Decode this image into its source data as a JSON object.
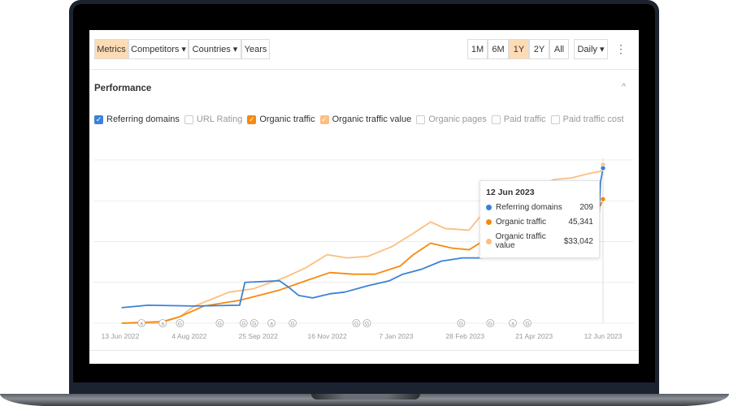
{
  "toolbar": {
    "left": [
      "Metrics",
      "Competitors ▾",
      "Countries ▾",
      "Years"
    ],
    "ranges": [
      "1M",
      "6M",
      "1Y",
      "2Y",
      "All"
    ],
    "active_range": "1Y",
    "interval": "Daily ▾",
    "more": "⋮"
  },
  "section": {
    "title": "Performance",
    "collapse": "^"
  },
  "metrics": [
    {
      "label": "Referring domains",
      "checked": true,
      "color": "#3b82d6"
    },
    {
      "label": "URL Rating",
      "checked": false,
      "color": ""
    },
    {
      "label": "Organic traffic",
      "checked": true,
      "color": "#f7890e"
    },
    {
      "label": "Organic traffic value",
      "checked": true,
      "color": "#fbbf80"
    },
    {
      "label": "Organic pages",
      "checked": false,
      "color": ""
    },
    {
      "label": "Paid traffic",
      "checked": false,
      "color": ""
    },
    {
      "label": "Paid traffic cost",
      "checked": false,
      "color": ""
    }
  ],
  "tooltip": {
    "date": "12 Jun 2023",
    "rows": [
      {
        "label": "Referring domains",
        "value": "209",
        "color": "#3b82d6"
      },
      {
        "label": "Organic traffic",
        "value": "45,341",
        "color": "#f7890e"
      },
      {
        "label": "Organic traffic value",
        "value": "$33,042",
        "color": "#fbbf80"
      }
    ]
  },
  "chart_data": {
    "type": "line",
    "x_unit": "days since 13 Jun 2022",
    "y_unit": "relative (0-100)",
    "ylim": [
      0,
      100
    ],
    "xlim": [
      0,
      364
    ],
    "grid": true,
    "x_ticks": [
      {
        "label": "13 Jun 2022",
        "day": 0
      },
      {
        "label": "4 Aug 2022",
        "day": 52
      },
      {
        "label": "25 Sep 2022",
        "day": 104
      },
      {
        "label": "16 Nov 2022",
        "day": 156
      },
      {
        "label": "7 Jan 2023",
        "day": 208
      },
      {
        "label": "28 Feb 2023",
        "day": 260
      },
      {
        "label": "21 Apr 2023",
        "day": 312
      },
      {
        "label": "12 Jun 2023",
        "day": 364
      }
    ],
    "series": [
      {
        "name": "Organic traffic value",
        "color": "#fbbf80",
        "points": [
          [
            1,
            0
          ],
          [
            30,
            0
          ],
          [
            45,
            4
          ],
          [
            56,
            10.5
          ],
          [
            82,
            19
          ],
          [
            100,
            21
          ],
          [
            124,
            28
          ],
          [
            140,
            34
          ],
          [
            156,
            42
          ],
          [
            171,
            40
          ],
          [
            187,
            41
          ],
          [
            205,
            47
          ],
          [
            219,
            54
          ],
          [
            234,
            62
          ],
          [
            245,
            58
          ],
          [
            263,
            57
          ],
          [
            271,
            65
          ],
          [
            290,
            72
          ],
          [
            310,
            82
          ],
          [
            327,
            88
          ],
          [
            340,
            89
          ],
          [
            355,
            92
          ],
          [
            362,
            93
          ],
          [
            364,
            97
          ]
        ]
      },
      {
        "name": "Organic traffic",
        "color": "#f7890e",
        "points": [
          [
            1,
            0
          ],
          [
            32,
            1
          ],
          [
            45,
            4
          ],
          [
            63,
            10.5
          ],
          [
            90,
            14
          ],
          [
            119,
            20
          ],
          [
            140,
            26
          ],
          [
            158,
            31
          ],
          [
            176,
            30
          ],
          [
            192,
            30
          ],
          [
            211,
            35
          ],
          [
            221,
            42
          ],
          [
            234,
            49
          ],
          [
            250,
            46
          ],
          [
            263,
            45
          ],
          [
            271,
            49
          ],
          [
            290,
            52
          ],
          [
            320,
            60
          ],
          [
            350,
            68
          ],
          [
            362,
            72
          ],
          [
            364,
            76
          ]
        ]
      },
      {
        "name": "Referring domains",
        "color": "#3b82d6",
        "points": [
          [
            1,
            9.5
          ],
          [
            21,
            11
          ],
          [
            56,
            10.5
          ],
          [
            90,
            11
          ],
          [
            94,
            25
          ],
          [
            120,
            26
          ],
          [
            127,
            22
          ],
          [
            134.5,
            17
          ],
          [
            145,
            15.5
          ],
          [
            158,
            18
          ],
          [
            169,
            19
          ],
          [
            187,
            23
          ],
          [
            203,
            26
          ],
          [
            213,
            30
          ],
          [
            227,
            33
          ],
          [
            242,
            38
          ],
          [
            258,
            40
          ],
          [
            271,
            40
          ],
          [
            300,
            43
          ],
          [
            330,
            45
          ],
          [
            360,
            48
          ],
          [
            362,
            86
          ],
          [
            364,
            95
          ]
        ]
      }
    ],
    "annotations": [
      {
        "day": 16,
        "label": "a"
      },
      {
        "day": 32,
        "label": "a"
      },
      {
        "day": 45,
        "label": "G"
      },
      {
        "day": 75,
        "label": "G"
      },
      {
        "day": 93,
        "label": "G"
      },
      {
        "day": 101,
        "label": "G"
      },
      {
        "day": 114,
        "label": "a"
      },
      {
        "day": 130,
        "label": "G"
      },
      {
        "day": 178,
        "label": "G"
      },
      {
        "day": 186,
        "label": "G"
      },
      {
        "day": 257,
        "label": "G"
      },
      {
        "day": 279,
        "label": "G"
      },
      {
        "day": 296,
        "label": "a"
      },
      {
        "day": 307,
        "label": "G"
      }
    ]
  }
}
